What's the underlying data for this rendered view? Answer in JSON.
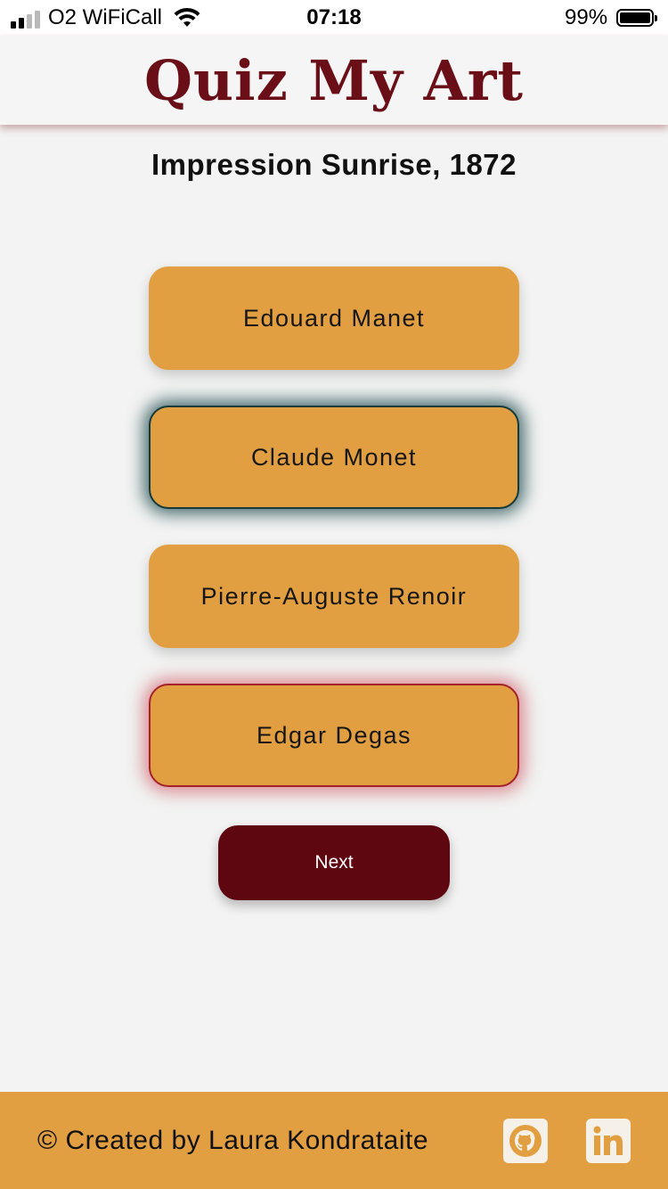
{
  "status_bar": {
    "carrier": "O2 WiFiCall",
    "time": "07:18",
    "battery": "99%",
    "battery_level": 0.99,
    "signal_bars": 2
  },
  "header": {
    "title": "Quiz My Art",
    "title_color": "#6a0f18"
  },
  "quiz": {
    "question": "Impression Sunrise, 1872",
    "answers": [
      {
        "label": "Edouard Manet",
        "state": "default"
      },
      {
        "label": "Claude Monet",
        "state": "correct"
      },
      {
        "label": "Pierre-Auguste Renoir",
        "state": "default"
      },
      {
        "label": "Edgar Degas",
        "state": "wrong"
      }
    ],
    "next_label": "Next"
  },
  "footer": {
    "credit": "© Created by Laura Kondrataite",
    "icons": [
      "github-icon",
      "linkedin-icon"
    ]
  },
  "colors": {
    "accent": "#e19f41",
    "brand": "#5e0710",
    "correct_glow": "#143a3c",
    "wrong_glow": "#c42838"
  }
}
